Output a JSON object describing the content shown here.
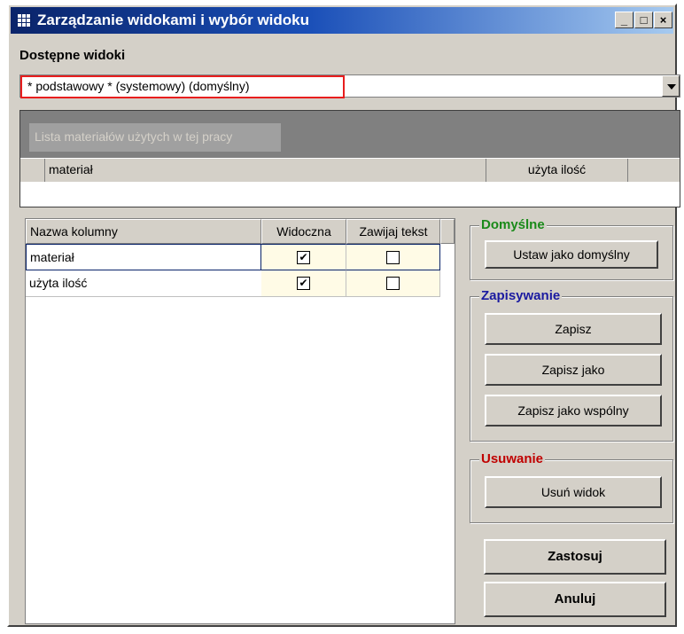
{
  "window": {
    "title": "Zarządzanie widokami i wybór widoku",
    "minimize_label": "_",
    "maximize_label": "□",
    "close_label": "×"
  },
  "views": {
    "label": "Dostępne widoki",
    "selected": "* podstawowy * (systemowy)  (domyślny)"
  },
  "preview": {
    "caption": "Lista materiałów użytych w tej pracy",
    "columns": [
      "materiał",
      "użyta ilość"
    ]
  },
  "columns_grid": {
    "headers": [
      "Nazwa kolumny",
      "Widoczna",
      "Zawijaj tekst"
    ],
    "rows": [
      {
        "name": "materiał",
        "visible": "✔",
        "wrap": ""
      },
      {
        "name": "użyta ilość",
        "visible": "✔",
        "wrap": ""
      }
    ]
  },
  "groups": {
    "default": {
      "title": "Domyślne",
      "title_color": "#1a8a1a",
      "set_default": "Ustaw jako domyślny"
    },
    "saving": {
      "title": "Zapisywanie",
      "title_color": "#1a1aa0",
      "save": "Zapisz",
      "save_as": "Zapisz jako",
      "save_as_shared": "Zapisz jako wspólny"
    },
    "delete": {
      "title": "Usuwanie",
      "title_color": "#c00000",
      "delete_view": "Usuń widok"
    }
  },
  "actions": {
    "apply": "Zastosuj",
    "cancel": "Anuluj"
  }
}
